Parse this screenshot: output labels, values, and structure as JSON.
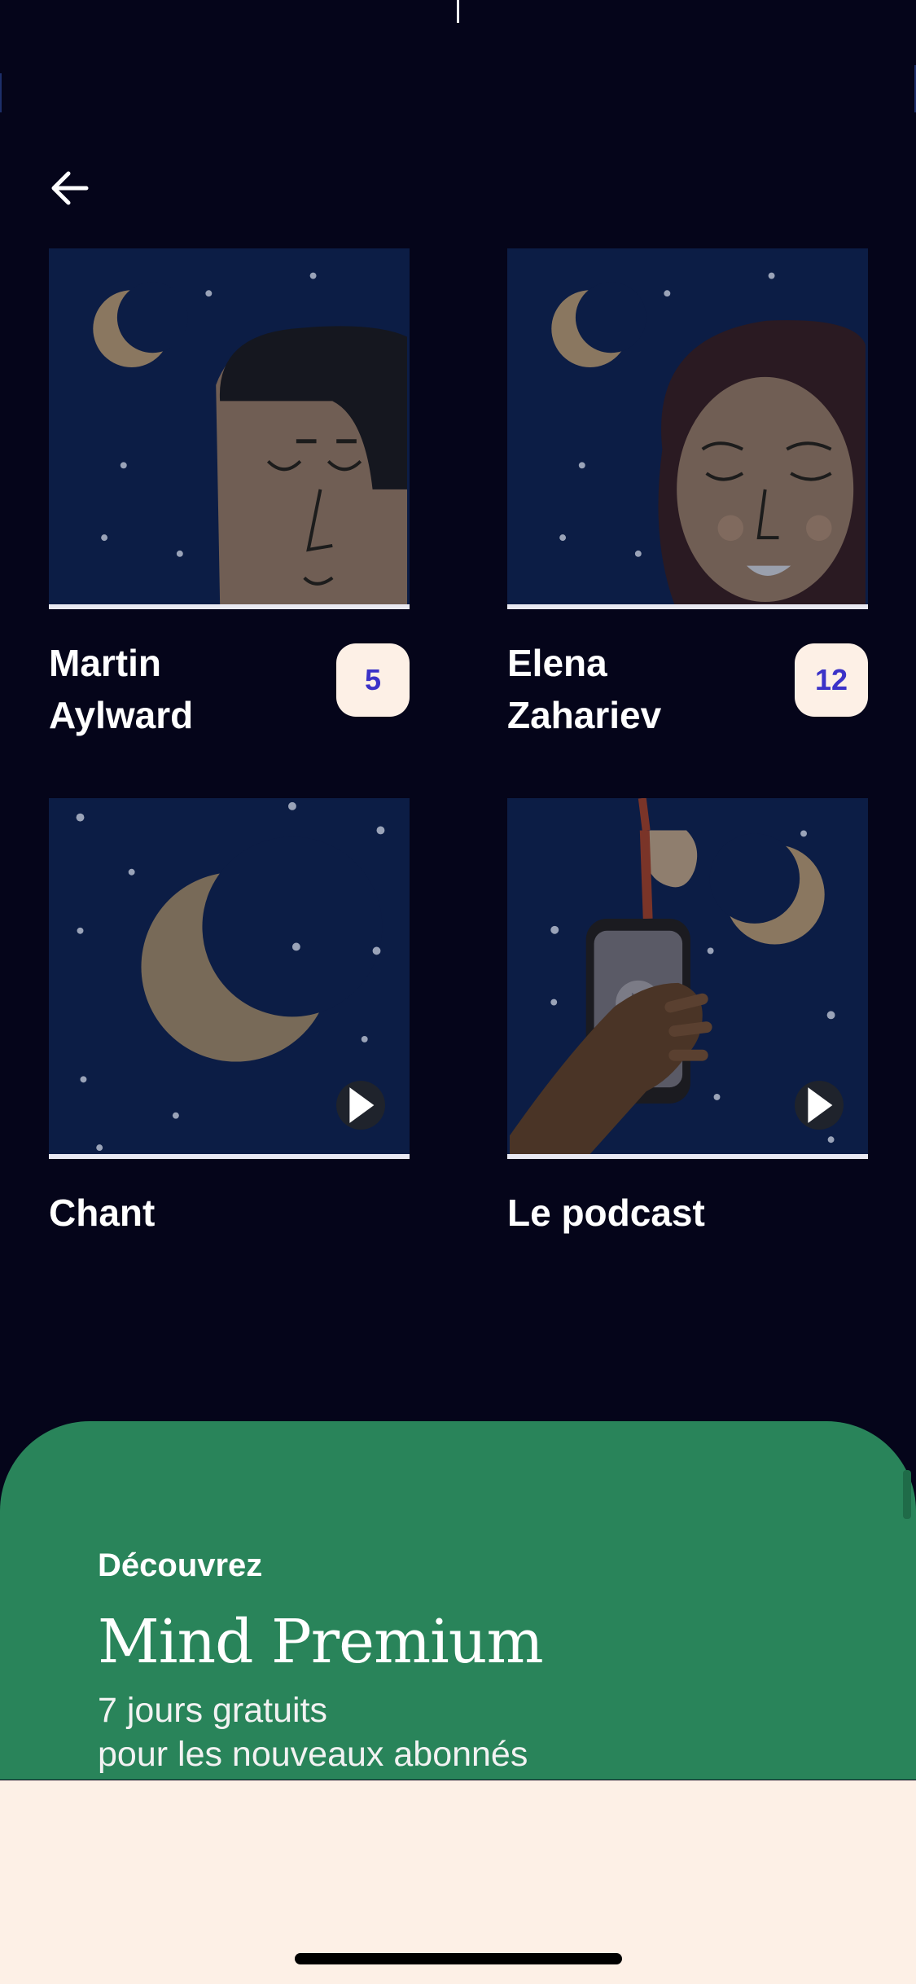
{
  "header": {
    "back_icon": "arrow-left-icon"
  },
  "cards": [
    {
      "id": "martin",
      "title_line1": "Martin",
      "title_line2": "Aylward",
      "count": "5"
    },
    {
      "id": "elena",
      "title_line1": "Elena",
      "title_line2": "Zahariev",
      "count": "12"
    },
    {
      "id": "chant",
      "title_line1": "Chant",
      "title_line2": "",
      "play_icon": "play-icon"
    },
    {
      "id": "podcast",
      "title_line1": "Le podcast",
      "title_line2": "",
      "play_icon": "play-icon"
    }
  ],
  "premium": {
    "eyebrow": "Découvrez",
    "headline": "Mind Premium",
    "sub_line1": "7 jours gratuits",
    "sub_line2": "pour les nouveaux abonnés"
  },
  "colors": {
    "background": "#05051a",
    "card_bg": "#0c1d45",
    "badge_bg": "#fdf0e6",
    "badge_text": "#3b32c8",
    "premium_green": "#29845a",
    "sheet_cream": "#fdf0e6"
  }
}
